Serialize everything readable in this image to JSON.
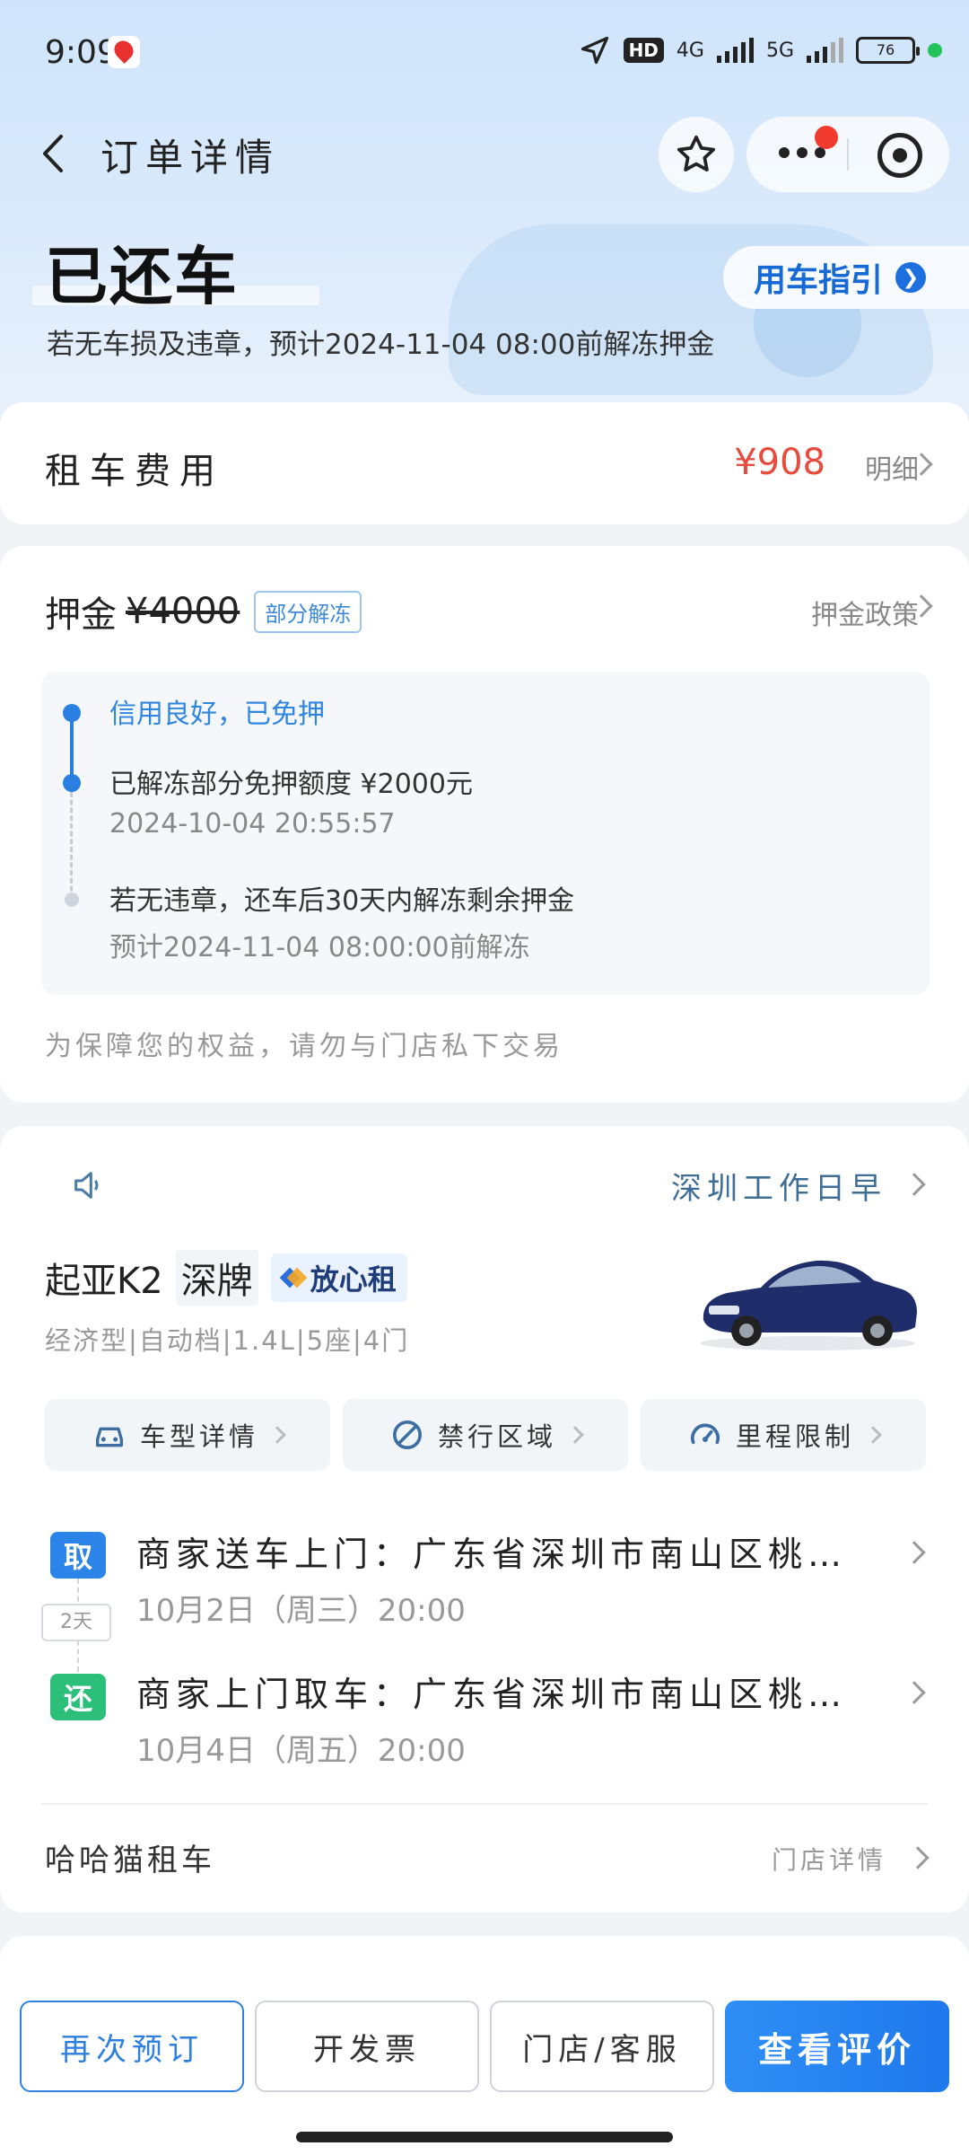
{
  "status_bar": {
    "time": "9:09",
    "hd": "HD",
    "net1": "4G",
    "net2": "5G",
    "battery": "76"
  },
  "nav": {
    "title": "订单详情"
  },
  "order": {
    "status": "已还车",
    "subtitle": "若无车损及违章，预计2024-11-04 08:00前解冻押金",
    "guide_label": "用车指引"
  },
  "fee": {
    "label": "租车费用",
    "amount": "¥908",
    "detail": "明细"
  },
  "deposit": {
    "label": "押金",
    "original": "¥4000",
    "tag": "部分解冻",
    "policy": "押金政策",
    "timeline": [
      {
        "text": "信用良好，已免押"
      },
      {
        "text": "已解冻部分免押额度 ¥2000元",
        "time": "2024-10-04 20:55:57"
      },
      {
        "text": "若无违章，还车后30天内解冻剩余押金",
        "time": "预计2024-11-04 08:00:00前解冻"
      }
    ],
    "note": "为保障您的权益，请勿与门店私下交易"
  },
  "car": {
    "business": "深圳工作日早",
    "name": "起亚K2",
    "plate": "深牌",
    "trust_label": "放心租",
    "specs": "经济型|自动档|1.4L|5座|4门",
    "chips": [
      {
        "label": "车型详情",
        "icon": "car-icon"
      },
      {
        "label": "禁行区域",
        "icon": "forbidden-icon"
      },
      {
        "label": "里程限制",
        "icon": "speedometer-icon"
      }
    ],
    "pickup": {
      "badge": "取",
      "title": "商家送车上门：广东省深圳市南山区桃源街道…",
      "time": "10月2日（周三）20:00"
    },
    "duration": "2天",
    "return": {
      "badge": "还",
      "title": "商家上门取车：广东省深圳市南山区桃源街道…",
      "time": "10月4日（周五）20:00"
    },
    "store": "哈哈猫租车",
    "store_detail": "门店详情"
  },
  "bottom": {
    "rebook": "再次预订",
    "invoice": "开发票",
    "service": "门店/客服",
    "review": "查看评价"
  },
  "colors": {
    "accent": "#2d7fe0",
    "price": "#e84a3c",
    "take": "#2c84e8",
    "return": "#2bbf7a"
  }
}
